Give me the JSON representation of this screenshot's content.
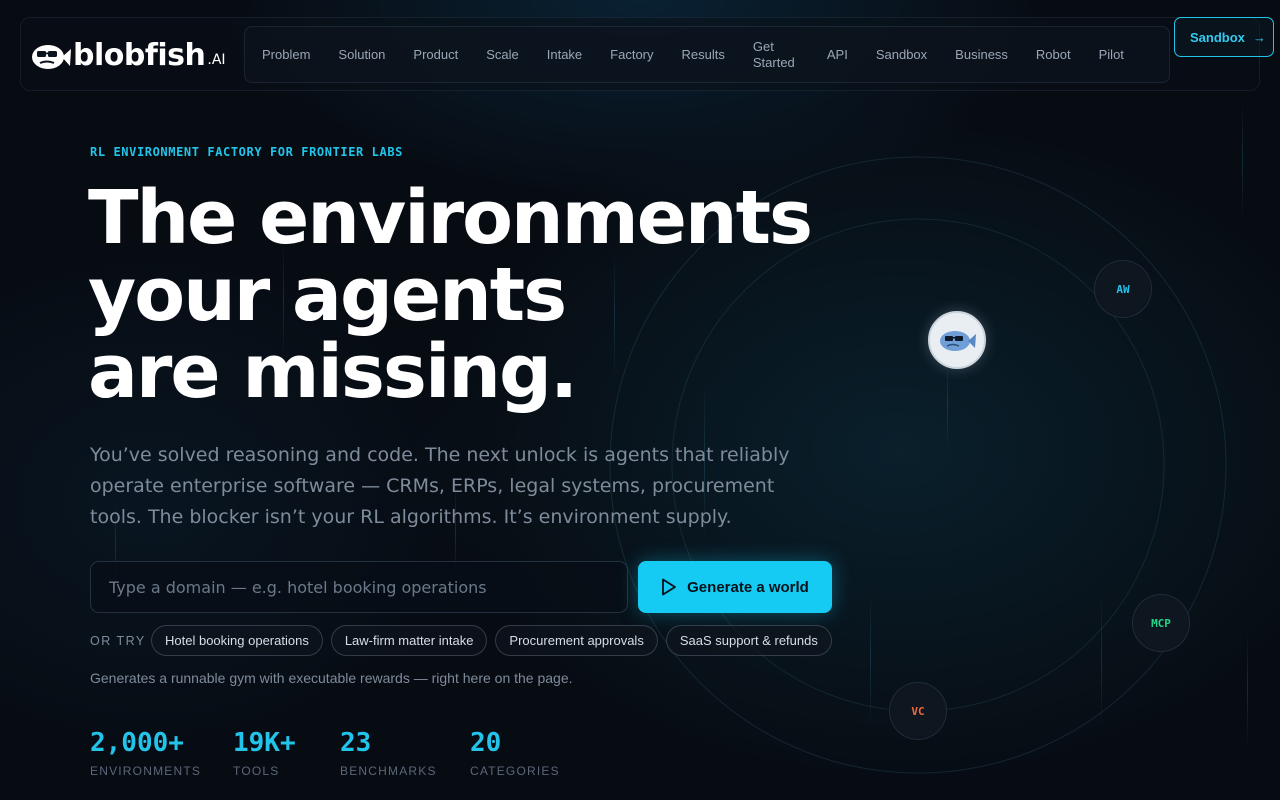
{
  "brand": {
    "name": "blobfish",
    "suffix": ".AI"
  },
  "nav": {
    "items": [
      {
        "label": "Problem"
      },
      {
        "label": "Solution"
      },
      {
        "label": "Product"
      },
      {
        "label": "Scale"
      },
      {
        "label": "Intake"
      },
      {
        "label": "Factory"
      },
      {
        "label": "Results"
      },
      {
        "label": "Get Started"
      },
      {
        "label": "API"
      },
      {
        "label": "Sandbox"
      },
      {
        "label": "Business"
      },
      {
        "label": "Robot"
      },
      {
        "label": "Pilot"
      }
    ],
    "cta_label": "Sandbox",
    "cta_arrow": "→"
  },
  "hero": {
    "eyebrow": "RL ENVIRONMENT FACTORY FOR FRONTIER LABS",
    "headline_line1": "The environments",
    "headline_line2": "your agents",
    "headline_line3": "are missing.",
    "subtext": "You’ve solved reasoning and code. The next unlock is agents that reliably operate enterprise software — CRMs, ERPs, legal systems, procurement tools. The blocker isn’t your RL algorithms. It’s environment supply.",
    "search_placeholder": "Type a domain — e.g. hotel booking operations",
    "search_value": "",
    "generate_label": "Generate a world",
    "or_try": "OR TRY",
    "chips": [
      {
        "label": "Hotel booking operations"
      },
      {
        "label": "Law-firm matter intake"
      },
      {
        "label": "Procurement approvals"
      },
      {
        "label": "SaaS support & refunds"
      }
    ],
    "note": "Generates a runnable gym with executable rewards — right here on the page."
  },
  "stats": [
    {
      "value": "2,000+",
      "label": "ENVIRONMENTS"
    },
    {
      "value": "19K+",
      "label": "TOOLS"
    },
    {
      "value": "23",
      "label": "BENCHMARKS"
    },
    {
      "value": "20",
      "label": "CATEGORIES"
    }
  ],
  "orbit_nodes": [
    {
      "label": "AW",
      "color": "#22c4ea"
    },
    {
      "label": "MCP",
      "color": "#22d68a"
    },
    {
      "label": "VC",
      "color": "#f06a3a"
    }
  ],
  "colors": {
    "accent": "#22c4ea",
    "button": "#15cbf3",
    "background": "#070b12"
  }
}
